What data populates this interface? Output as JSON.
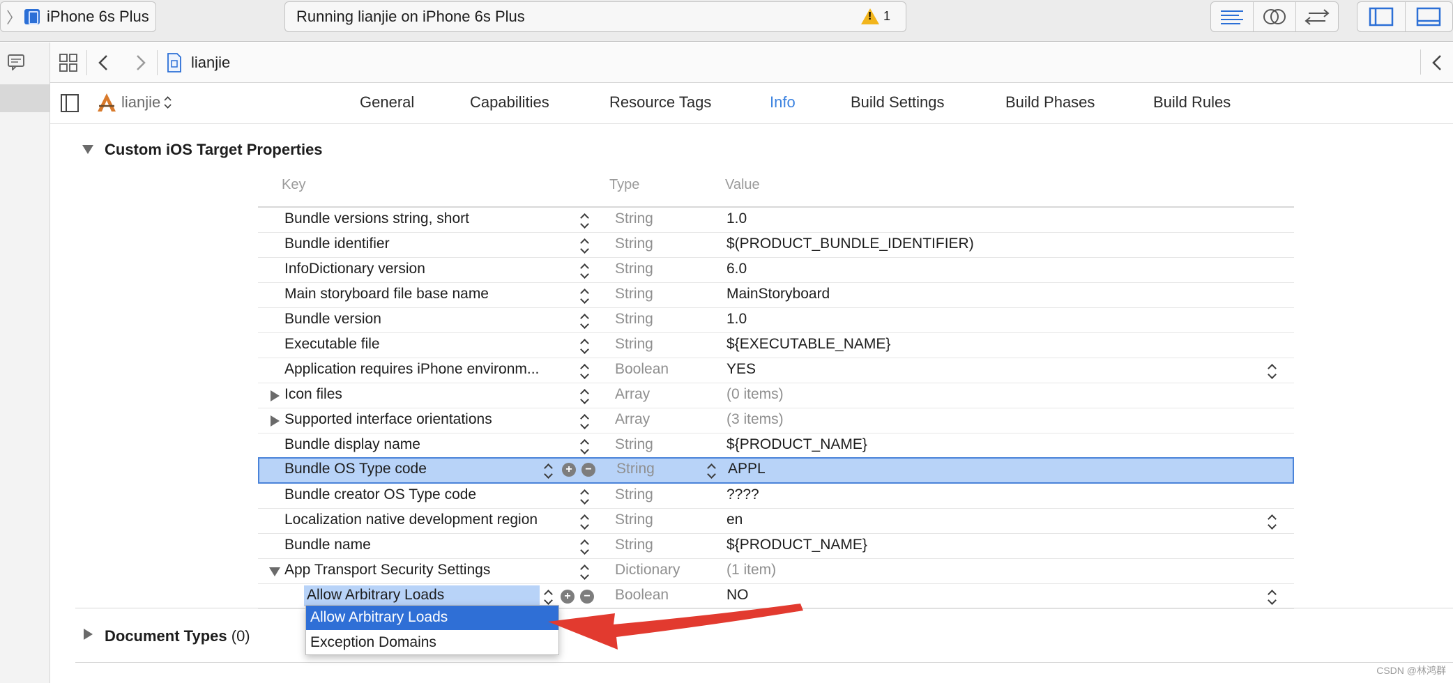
{
  "toolbar": {
    "scheme_device": "iPhone 6s Plus",
    "activity_text": "Running lianjie on iPhone 6s Plus",
    "warning_count": "1",
    "colors": {
      "warning": "#f2b51c",
      "accent_blue": "#2b6fd6"
    }
  },
  "jumpbar": {
    "file_name": "lianjie"
  },
  "target": {
    "name": "lianjie"
  },
  "tabs": [
    {
      "label": "General"
    },
    {
      "label": "Capabilities"
    },
    {
      "label": "Resource Tags"
    },
    {
      "label": "Info",
      "active": true
    },
    {
      "label": "Build Settings"
    },
    {
      "label": "Build Phases"
    },
    {
      "label": "Build Rules"
    }
  ],
  "section": {
    "title": "Custom iOS Target Properties"
  },
  "columns": {
    "key": "Key",
    "type": "Type",
    "value": "Value"
  },
  "rows": [
    {
      "key": "Bundle versions string, short",
      "type": "String",
      "value": "1.0"
    },
    {
      "key": "Bundle identifier",
      "type": "String",
      "value": "$(PRODUCT_BUNDLE_IDENTIFIER)"
    },
    {
      "key": "InfoDictionary version",
      "type": "String",
      "value": "6.0"
    },
    {
      "key": "Main storyboard file base name",
      "type": "String",
      "value": "MainStoryboard"
    },
    {
      "key": "Bundle version",
      "type": "String",
      "value": "1.0"
    },
    {
      "key": "Executable file",
      "type": "String",
      "value": "${EXECUTABLE_NAME}"
    },
    {
      "key": "Application requires iPhone environm...",
      "type": "Boolean",
      "value": "YES"
    },
    {
      "key": "Icon files",
      "type": "Array",
      "value": "(0 items)"
    },
    {
      "key": "Supported interface orientations",
      "type": "Array",
      "value": "(3 items)"
    },
    {
      "key": "Bundle display name",
      "type": "String",
      "value": "${PRODUCT_NAME}"
    },
    {
      "key": "Bundle OS Type code",
      "type": "String",
      "value": "APPL"
    },
    {
      "key": "Bundle creator OS Type code",
      "type": "String",
      "value": "????"
    },
    {
      "key": "Localization native development region",
      "type": "String",
      "value": "en"
    },
    {
      "key": "Bundle name",
      "type": "String",
      "value": "${PRODUCT_NAME}"
    },
    {
      "key": "App Transport Security Settings",
      "type": "Dictionary",
      "value": "(1 item)"
    },
    {
      "key": "Allow Arbitrary Loads",
      "type": "Boolean",
      "value": "NO"
    }
  ],
  "dropdown": {
    "options": [
      "Allow Arbitrary Loads",
      "Exception Domains"
    ]
  },
  "doc_types": {
    "label": "Document Types",
    "count": "(0)"
  },
  "watermark": "CSDN @林鸿群"
}
